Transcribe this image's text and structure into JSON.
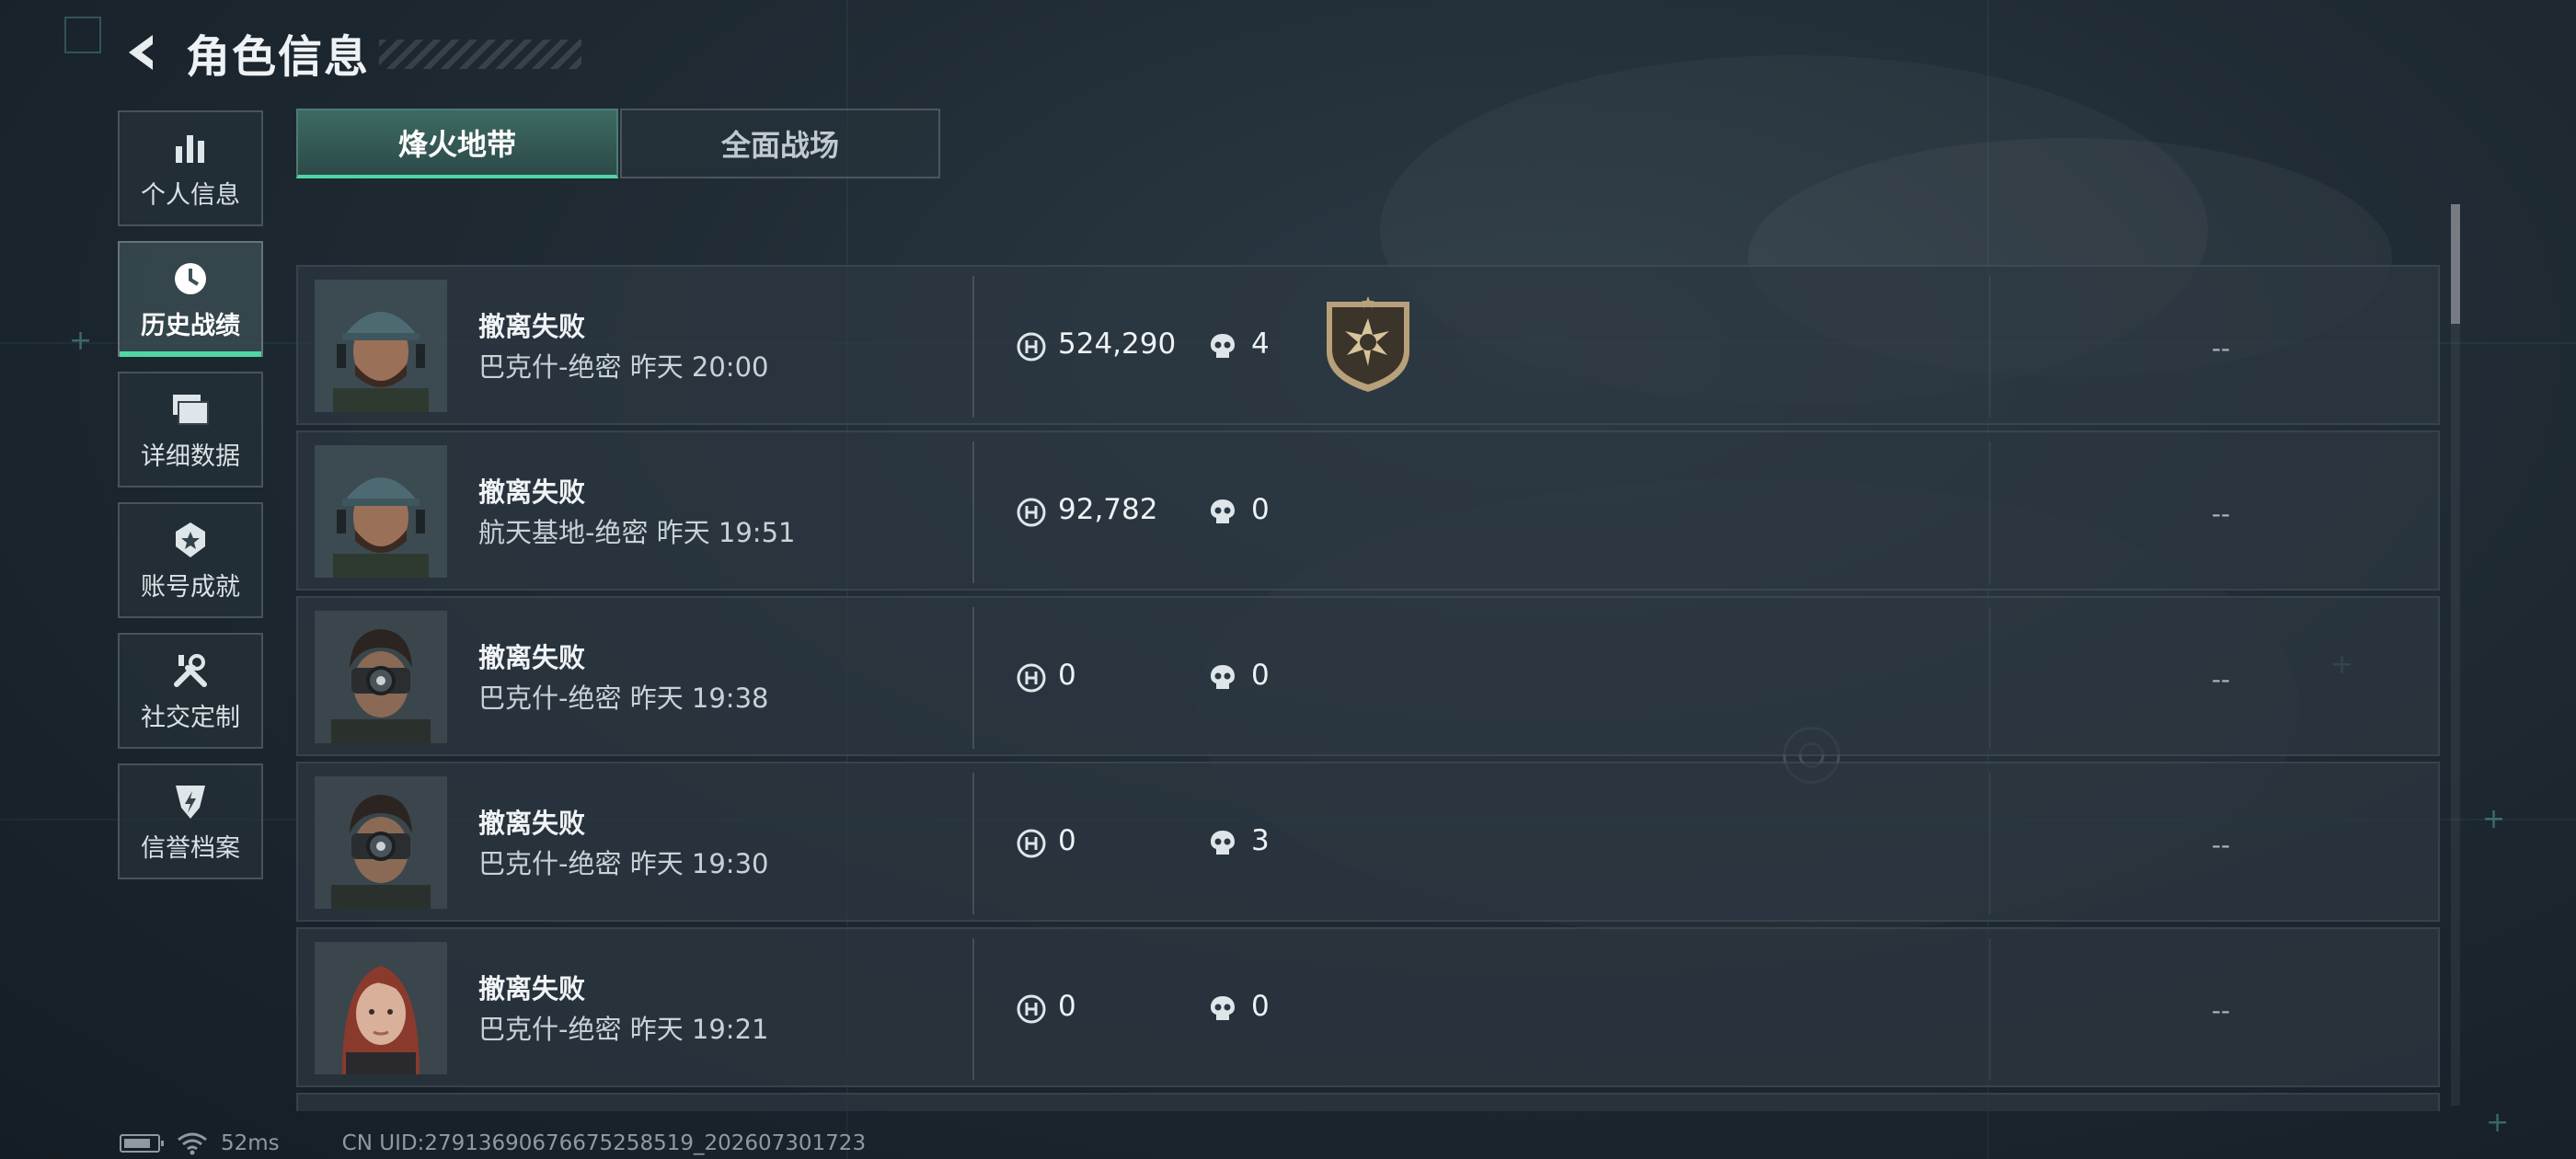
{
  "header": {
    "title": "角色信息",
    "back_icon": "back-arrow-icon"
  },
  "sidebar": {
    "items": [
      {
        "label": "个人信息",
        "icon": "bar-chart-icon",
        "active": false
      },
      {
        "label": "历史战绩",
        "icon": "history-clock-icon",
        "active": true
      },
      {
        "label": "详细数据",
        "icon": "folder-icon",
        "active": false
      },
      {
        "label": "账号成就",
        "icon": "achievement-badge-icon",
        "active": false
      },
      {
        "label": "社交定制",
        "icon": "tools-icon",
        "active": false
      },
      {
        "label": "信誉档案",
        "icon": "credit-shield-icon",
        "active": false
      }
    ]
  },
  "tabs": [
    {
      "label": "烽火地带",
      "active": true
    },
    {
      "label": "全面战场",
      "active": false
    }
  ],
  "records": [
    {
      "status": "撤离失败",
      "map": "巴克什-绝密",
      "time": "昨天 20:00",
      "value": "524,290",
      "kills": "4",
      "rating": "--",
      "has_badge": true,
      "portrait": "male-cap"
    },
    {
      "status": "撤离失败",
      "map": "航天基地-绝密",
      "time": "昨天 19:51",
      "value": "92,782",
      "kills": "0",
      "rating": "--",
      "has_badge": false,
      "portrait": "male-cap"
    },
    {
      "status": "撤离失败",
      "map": "巴克什-绝密",
      "time": "昨天 19:38",
      "value": "0",
      "kills": "0",
      "rating": "--",
      "has_badge": false,
      "portrait": "male-goggles"
    },
    {
      "status": "撤离失败",
      "map": "巴克什-绝密",
      "time": "昨天 19:30",
      "value": "0",
      "kills": "3",
      "rating": "--",
      "has_badge": false,
      "portrait": "male-goggles"
    },
    {
      "status": "撤离失败",
      "map": "巴克什-绝密",
      "time": "昨天 19:21",
      "value": "0",
      "kills": "0",
      "rating": "--",
      "has_badge": false,
      "portrait": "female-redhair"
    }
  ],
  "footer": {
    "ping": "52ms",
    "uid": "CN UID:27913690676675258519_202607301723"
  },
  "colors": {
    "accent": "#4fd6a3",
    "background": "#1f2a33",
    "row_bg": "#2c3841"
  }
}
